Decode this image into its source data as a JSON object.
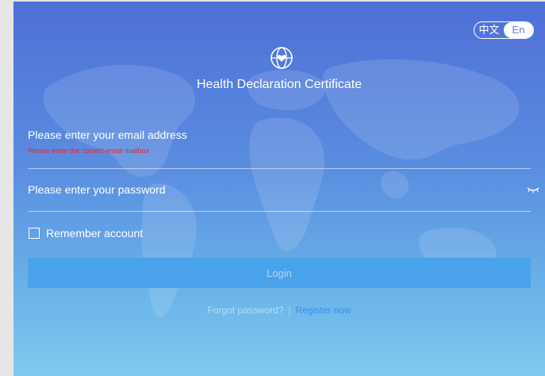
{
  "language": {
    "chinese": "中文",
    "english": "En"
  },
  "app": {
    "title": "Health Declaration Certificate"
  },
  "form": {
    "email_placeholder": "Please enter your email address",
    "email_error": "Please enter the correct email mailbox",
    "password_placeholder": "Please enter your password",
    "remember_label": "Remember account",
    "login_label": "Login",
    "forgot_label": "Forgot password?",
    "separator": "|",
    "register_label": "Register now"
  },
  "colors": {
    "error": "#e8243a",
    "link": "#3b8ef0",
    "button": "#4aa3ea"
  }
}
